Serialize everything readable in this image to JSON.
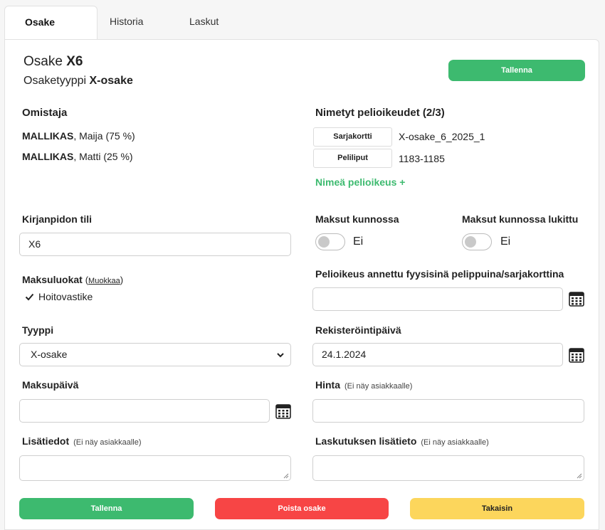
{
  "tabs": [
    "Osake",
    "Historia",
    "Laskut"
  ],
  "header": {
    "osake_prefix": "Osake",
    "osake_id": "X6",
    "type_prefix": "Osaketyyppi",
    "type_value": "X-osake",
    "save_label": "Tallenna"
  },
  "owners": {
    "title": "Omistaja",
    "items": [
      {
        "surname": "MALLIKAS",
        "rest": ", Maija (75 %)"
      },
      {
        "surname": "MALLIKAS",
        "rest": ", Matti (25 %)"
      }
    ]
  },
  "rights": {
    "title": "Nimetyt pelioikeudet (2/3)",
    "items": [
      {
        "button": "Sarjakortti",
        "value": "X-osake_6_2025_1"
      },
      {
        "button": "Peliliput",
        "value": "1183-1185"
      }
    ],
    "add_link": "Nimeä pelioikeus +"
  },
  "account": {
    "label": "Kirjanpidon tili",
    "value": "X6"
  },
  "payments_ok": {
    "label": "Maksut kunnossa",
    "state": "Ei"
  },
  "payments_locked": {
    "label": "Maksut kunnossa lukittu",
    "state": "Ei"
  },
  "fee_classes": {
    "label": "Maksuluokat",
    "edit_link": "Muokkaa",
    "open_paren": "(",
    "close_paren": ")",
    "items": [
      "Hoitovastike"
    ]
  },
  "physical": {
    "label": "Pelioikeus annettu fyysisinä pelippuina/sarjakorttina",
    "value": ""
  },
  "type_field": {
    "label": "Tyyppi",
    "value": "X-osake"
  },
  "registration": {
    "label": "Rekisteröintipäivä",
    "value": "24.1.2024"
  },
  "payment_day": {
    "label": "Maksupäivä",
    "value": ""
  },
  "price": {
    "label": "Hinta",
    "note": "(Ei näy asiakkaalle)",
    "value": ""
  },
  "extra_info": {
    "label": "Lisätiedot",
    "note": "(Ei näy asiakkaalle)"
  },
  "billing_info": {
    "label": "Laskutuksen lisätieto",
    "note": "(Ei näy asiakkaalle)"
  },
  "footer": {
    "save": "Tallenna",
    "delete": "Poista osake",
    "back": "Takaisin"
  },
  "colors": {
    "green": "#3dba6f",
    "red": "#f74545",
    "yellow": "#fcd65c"
  }
}
